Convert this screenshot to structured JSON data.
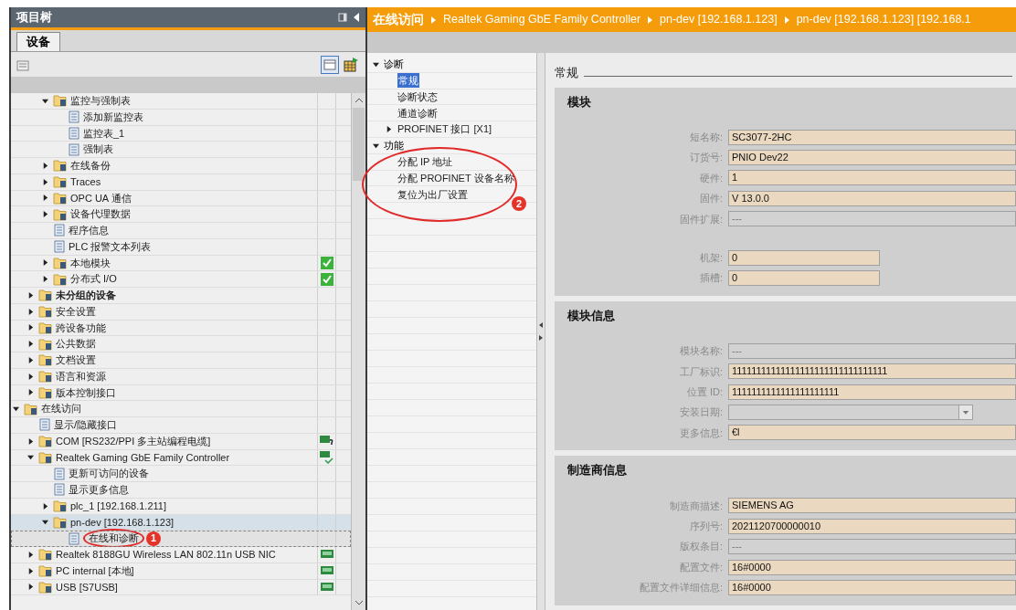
{
  "project_tree": {
    "title": "项目树",
    "tabs": [
      {
        "label": "设备",
        "selected": true
      }
    ],
    "items": [
      {
        "children": [
          {
            "children": [
              {
                "label": "监控与强制表",
                "kind": "folder",
                "expanded": true,
                "children": [
                  {
                    "label": "添加新监控表",
                    "kind": "item"
                  },
                  {
                    "label": "监控表_1",
                    "kind": "item"
                  },
                  {
                    "label": "强制表",
                    "kind": "item"
                  }
                ]
              },
              {
                "label": "在线备份",
                "kind": "folder",
                "expanded": false
              },
              {
                "label": "Traces",
                "kind": "folder",
                "expanded": false
              },
              {
                "label": "OPC UA 通信",
                "kind": "folder",
                "expanded": false
              },
              {
                "label": "设备代理数据",
                "kind": "folder",
                "expanded": false
              },
              {
                "label": "程序信息",
                "kind": "item"
              },
              {
                "label": "PLC 报警文本列表",
                "kind": "item"
              },
              {
                "label": "本地模块",
                "kind": "folder",
                "expanded": false,
                "status_icon": {
                  "kind": "ok"
                }
              },
              {
                "label": "分布式 I/O",
                "kind": "folder",
                "expanded": false,
                "status_icon": {
                  "kind": "ok"
                }
              }
            ]
          },
          {
            "label": "未分组的设备",
            "kind": "folder",
            "expanded": false,
            "bold": true
          },
          {
            "label": "安全设置",
            "kind": "folder",
            "expanded": false
          },
          {
            "label": "跨设备功能",
            "kind": "folder",
            "expanded": false
          },
          {
            "label": "公共数据",
            "kind": "folder",
            "expanded": false
          },
          {
            "label": "文档设置",
            "kind": "folder",
            "expanded": false
          },
          {
            "label": "语言和资源",
            "kind": "folder",
            "expanded": false
          },
          {
            "label": "版本控制接口",
            "kind": "folder",
            "expanded": false
          }
        ]
      },
      {
        "label": "在线访问",
        "kind": "folder",
        "expanded": true,
        "children": [
          {
            "label": "显示/隐藏接口",
            "kind": "item"
          },
          {
            "label": "COM [RS232/PPI 多主站编程电缆]",
            "kind": "folder",
            "expanded": false,
            "status_icon": {
              "kind": "unknown"
            }
          },
          {
            "label": "Realtek Gaming GbE Family Controller",
            "kind": "folder",
            "expanded": true,
            "status_icon": {
              "kind": "connected"
            },
            "children": [
              {
                "label": "更新可访问的设备",
                "kind": "item"
              },
              {
                "label": "显示更多信息",
                "kind": "item"
              },
              {
                "label": "plc_1 [192.168.1.211]",
                "kind": "folder",
                "expanded": false
              },
              {
                "label": "pn-dev [192.168.1.123]",
                "kind": "folder",
                "expanded": true,
                "highlighted": true,
                "children": [
                  {
                    "label": "在线和诊断",
                    "kind": "item",
                    "selected": true,
                    "callout": "1"
                  }
                ]
              }
            ]
          },
          {
            "label": "Realtek 8188GU Wireless LAN 802.11n USB NIC",
            "kind": "folder",
            "expanded": false,
            "status_icon": {
              "kind": "adapter"
            }
          },
          {
            "label": "PC internal [本地]",
            "kind": "folder",
            "expanded": false,
            "status_icon": {
              "kind": "adapter"
            }
          },
          {
            "label": "USB [S7USB]",
            "kind": "folder",
            "expanded": false,
            "status_icon": {
              "kind": "adapter"
            }
          }
        ]
      }
    ]
  },
  "breadcrumb": [
    "在线访问",
    "Realtek Gaming GbE Family Controller",
    "pn-dev [192.168.1.123]",
    "pn-dev [192.168.1.123] [192.168.1"
  ],
  "nav": [
    {
      "label": "诊断",
      "expanded": true,
      "children": [
        {
          "label": "常规",
          "selected": true
        },
        {
          "label": "诊断状态",
          "selected": false
        },
        {
          "label": "通道诊断",
          "selected": false
        },
        {
          "label": "PROFINET 接口 [X1]",
          "selected": false,
          "expanded": false
        }
      ]
    },
    {
      "label": "功能",
      "expanded": true,
      "callout": "2",
      "children": [
        {
          "label": "分配 IP 地址",
          "selected": false
        },
        {
          "label": "分配 PROFINET 设备名称",
          "selected": false
        },
        {
          "label": "复位为出厂设置",
          "selected": false
        }
      ]
    }
  ],
  "content": {
    "heading": "常规",
    "panels": [
      {
        "title": "模块",
        "groups": [
          [
            {
              "label": "短名称:",
              "value": "SC3077-2HC",
              "disabled": false
            },
            {
              "label": "订货号:",
              "value": "PNIO Dev22",
              "disabled": false
            },
            {
              "label": "硬件:",
              "value": "1",
              "disabled": false
            },
            {
              "label": "固件:",
              "value": "V 13.0.0",
              "disabled": false
            },
            {
              "label": "固件扩展:",
              "value": "---",
              "disabled": true
            }
          ],
          [
            {
              "label": "机架:",
              "value": "0",
              "disabled": false,
              "kind": "short"
            },
            {
              "label": "插槽:",
              "value": "0",
              "disabled": false,
              "kind": "short"
            }
          ]
        ]
      },
      {
        "title": "模块信息",
        "groups": [
          [
            {
              "label": "模块名称:",
              "value": "---",
              "disabled": true
            },
            {
              "label": "工厂标识:",
              "value": "11111111111111111111111111111111",
              "disabled": false
            },
            {
              "label": "位置 ID:",
              "value": "1111111111111111111111",
              "disabled": false
            },
            {
              "label": "安装日期:",
              "disabled": true,
              "kind": "dropdown"
            },
            {
              "label": "更多信息:",
              "value": "€l",
              "disabled": false
            }
          ]
        ]
      },
      {
        "title": "制造商信息",
        "groups": [
          [
            {
              "label": "制造商描述:",
              "value": "SIEMENS AG",
              "disabled": false
            },
            {
              "label": "序列号:",
              "value": "2021120700000010",
              "disabled": false
            },
            {
              "label": "版权条目:",
              "value": "---",
              "disabled": true
            },
            {
              "label": "配置文件:",
              "value": "16#0000",
              "disabled": false
            },
            {
              "label": "配置文件详细信息:",
              "value": "16#0000",
              "disabled": false
            }
          ]
        ]
      }
    ]
  }
}
